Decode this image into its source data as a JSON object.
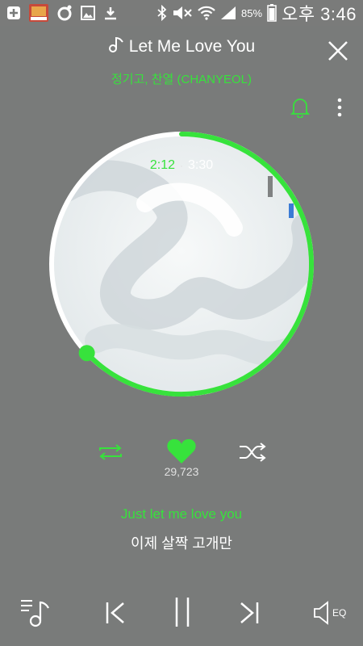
{
  "status_bar": {
    "battery_percent": "85%",
    "time": "오후 3:46",
    "icons": [
      "add-icon",
      "app-thumbnail-icon",
      "circle-app-icon",
      "image-icon",
      "download-icon",
      "bluetooth-icon",
      "mute-icon",
      "wifi-icon",
      "signal-icon",
      "battery-icon"
    ]
  },
  "player": {
    "title": "Let Me Love You",
    "artist": "정기고, 찬열 (CHANYEOL)",
    "elapsed": "2:12",
    "separator": "·",
    "total": "3:30",
    "progress": 0.63,
    "like_count": "29,723",
    "liked": true
  },
  "lyrics": {
    "current": "Just let me love you",
    "next": "이제 살짝 고개만"
  },
  "bottom_bar": {
    "eq_label": "EQ"
  },
  "colors": {
    "accent": "#37e23c",
    "background": "#797b7a",
    "text": "#ffffff"
  }
}
